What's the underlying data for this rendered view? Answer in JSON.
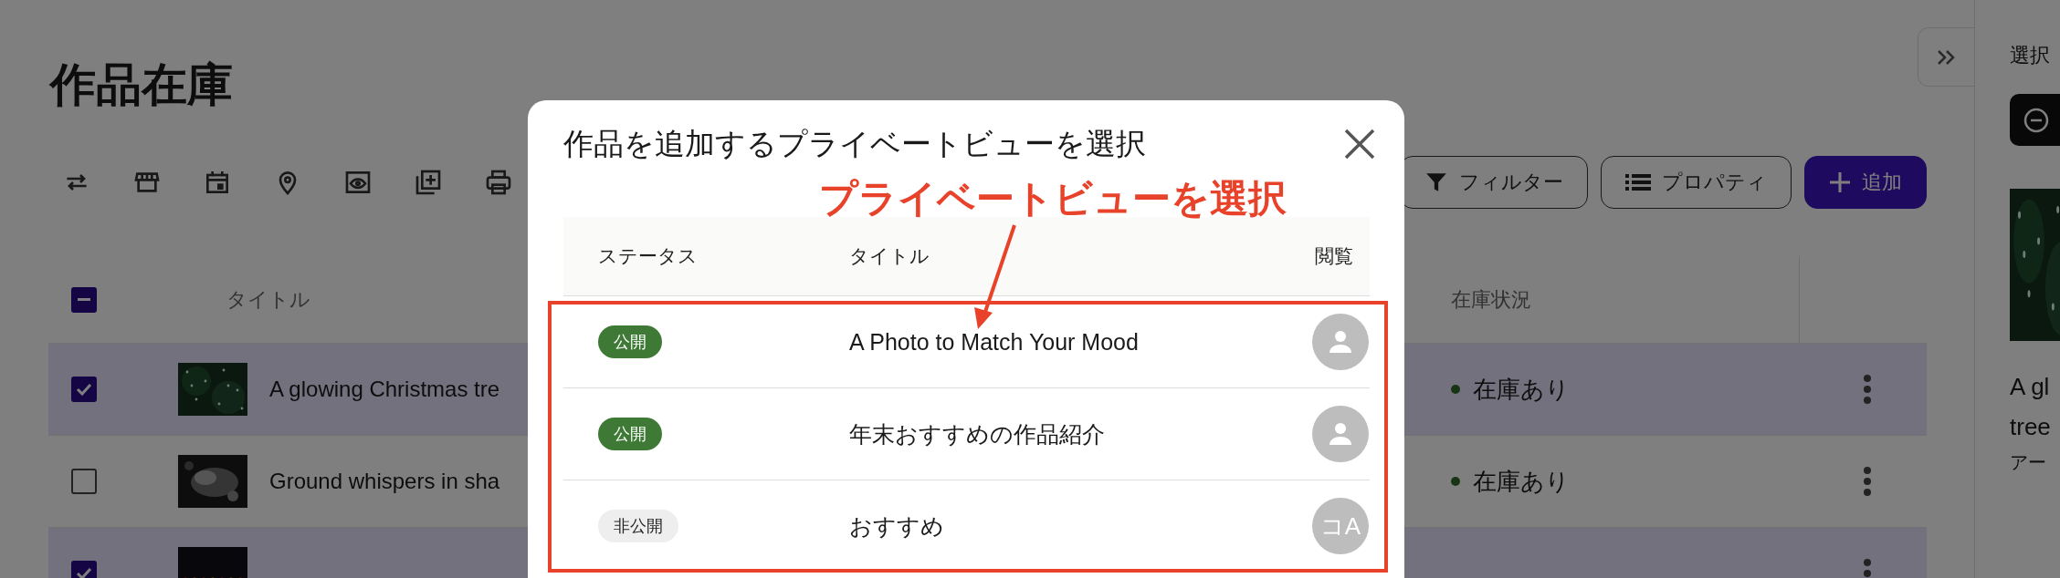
{
  "page": {
    "title": "作品在庫",
    "buttons": [
      {
        "label": "フィルター",
        "kind": "filter"
      },
      {
        "label": "プロパティ",
        "kind": "properties"
      },
      {
        "label": "追加",
        "kind": "add"
      }
    ]
  },
  "table": {
    "select_all_indeterminate": true,
    "columns": [
      "タイトル",
      "在庫状況"
    ],
    "rows": [
      {
        "selected": true,
        "title": "A glowing Christmas tre",
        "stock": "在庫あり"
      },
      {
        "selected": false,
        "title": "Ground whispers in sha",
        "stock": "在庫あり"
      },
      {
        "selected": true
      }
    ]
  },
  "side_panel": {
    "heading": "選択",
    "lines": [
      "A gl",
      "tree"
    ],
    "label": "アー"
  },
  "modal": {
    "title": "作品を追加するプライベートビューを選択",
    "columns": [
      "ステータス",
      "タイトル",
      "閲覧"
    ],
    "rows": [
      {
        "status": "公開",
        "published": true,
        "title": "A Photo to Match Your Mood",
        "viewer": {
          "kind": "icon"
        }
      },
      {
        "status": "公開",
        "published": true,
        "title": "年末おすすめの作品紹介",
        "viewer": {
          "kind": "icon"
        }
      },
      {
        "status": "非公開",
        "published": false,
        "title": "おすすめ",
        "viewer": {
          "kind": "initials",
          "text": "コA"
        }
      }
    ]
  },
  "annotation": {
    "text": "プライベートビューを選択"
  }
}
